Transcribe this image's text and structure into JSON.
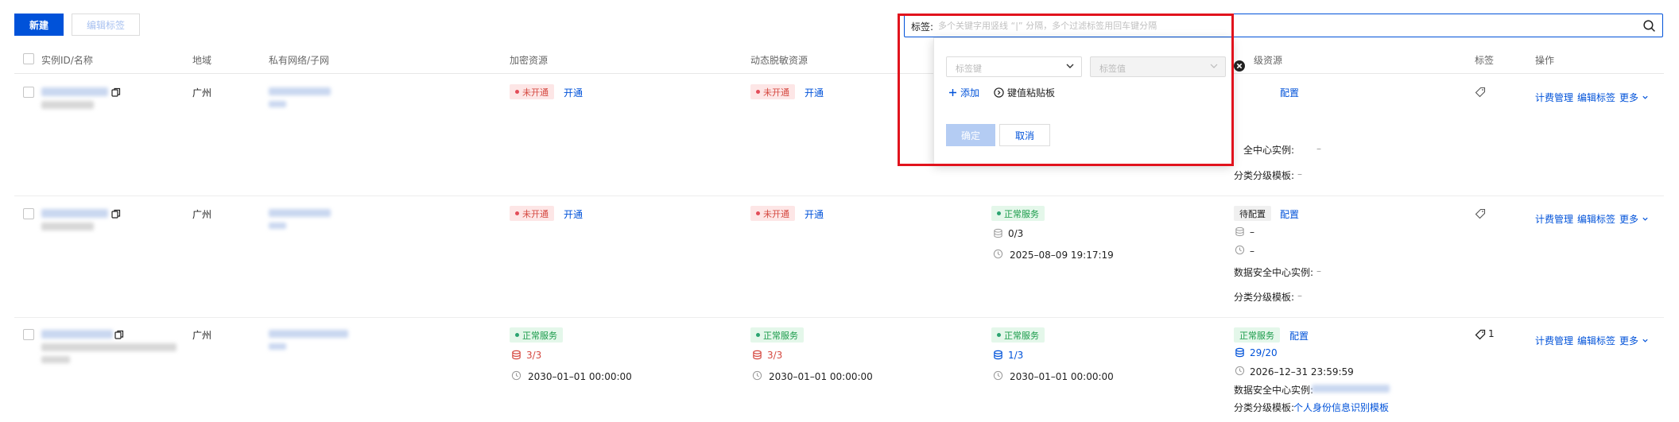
{
  "toolbar": {
    "new_label": "新建",
    "edit_tags_label": "编辑标签"
  },
  "search": {
    "label": "标签:",
    "placeholder": "多个关键字用竖线 “|” 分隔，多个过滤标签用回车键分隔"
  },
  "tag_popup": {
    "key_placeholder": "标签键",
    "value_placeholder": "标签值",
    "add_label": "添加",
    "clipboard_label": "键值粘贴板",
    "confirm_label": "确定",
    "cancel_label": "取消"
  },
  "columns": {
    "id_name": "实例ID/名称",
    "region": "地域",
    "vpc": "私有网络/子网",
    "encrypt": "加密资源",
    "mask": "动态脱敏资源",
    "classify": "级资源",
    "tags": "标签",
    "ops": "操作"
  },
  "rows": [
    {
      "region": "广州",
      "encrypt": {
        "status": "未开通",
        "action": "开通"
      },
      "mask": {
        "status": "未开通",
        "action": "开通"
      },
      "classify": {
        "action": "配置",
        "dsc_label": "全中心实例:",
        "dsc_value": "–",
        "tpl_label": "分类分级模板:",
        "tpl_value": "–"
      },
      "ops": {
        "billing": "计费管理",
        "edit_tags": "编辑标签",
        "more": "更多"
      }
    },
    {
      "region": "广州",
      "encrypt": {
        "status": "未开通",
        "action": "开通"
      },
      "mask": {
        "status": "未开通",
        "action": "开通"
      },
      "audit": {
        "status": "正常服务",
        "count": "0/3",
        "expire": "2025–08–09 19:17:19"
      },
      "classify": {
        "status": "待配置",
        "action": "配置",
        "count": "–",
        "expire": "–",
        "dsc_label": "数据安全中心实例:",
        "dsc_value": "–",
        "tpl_label": "分类分级模板:",
        "tpl_value": "–"
      },
      "ops": {
        "billing": "计费管理",
        "edit_tags": "编辑标签",
        "more": "更多"
      }
    },
    {
      "region": "广州",
      "encrypt": {
        "status": "正常服务",
        "count": "3/3",
        "expire": "2030–01–01 00:00:00"
      },
      "mask": {
        "status": "正常服务",
        "count": "3/3",
        "expire": "2030–01–01 00:00:00"
      },
      "audit": {
        "status": "正常服务",
        "count": "1/3",
        "expire": "2030–01–01 00:00:00"
      },
      "classify": {
        "status": "正常服务",
        "action": "配置",
        "count": "29/20",
        "expire": "2026–12–31 23:59:59",
        "dsc_label": "数据安全中心实例:",
        "tpl_label": "分类分级模板:",
        "tpl_value": "个人身份信息识别模板"
      },
      "tag_count": "1",
      "ops": {
        "billing": "计费管理",
        "edit_tags": "编辑标签",
        "more": "更多"
      }
    }
  ],
  "colors": {
    "primary": "#0052d9",
    "danger": "#d54941",
    "success": "#2ba471",
    "highlight": "#e1131d"
  }
}
